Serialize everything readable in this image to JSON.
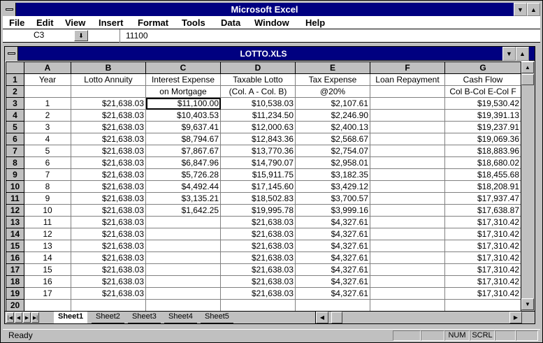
{
  "app": {
    "title": "Microsoft Excel"
  },
  "menu": [
    "File",
    "Edit",
    "View",
    "Insert",
    "Format",
    "Tools",
    "Data",
    "Window",
    "Help"
  ],
  "formula_bar": {
    "cell_ref": "C3",
    "value": "11100"
  },
  "workbook": {
    "title": "LOTTO.XLS"
  },
  "columns": [
    "A",
    "B",
    "C",
    "D",
    "E",
    "F",
    "G"
  ],
  "header_rows": [
    [
      "Year",
      "Lotto Annuity",
      "Interest Expense",
      "Taxable Lotto",
      "Tax Expense",
      "Loan Repayment",
      "Cash Flow"
    ],
    [
      "",
      "",
      "on Mortgage",
      "(Col. A - Col. B)",
      "@20%",
      "",
      "Col B-Col E-Col F"
    ]
  ],
  "data_rows": [
    [
      "1",
      "$21,638.03",
      "$11,100.00",
      "$10,538.03",
      "$2,107.61",
      "",
      "$19,530.42"
    ],
    [
      "2",
      "$21,638.03",
      "$10,403.53",
      "$11,234.50",
      "$2,246.90",
      "",
      "$19,391.13"
    ],
    [
      "3",
      "$21,638.03",
      "$9,637.41",
      "$12,000.63",
      "$2,400.13",
      "",
      "$19,237.91"
    ],
    [
      "4",
      "$21,638.03",
      "$8,794.67",
      "$12,843.36",
      "$2,568.67",
      "",
      "$19,069.36"
    ],
    [
      "5",
      "$21,638.03",
      "$7,867.67",
      "$13,770.36",
      "$2,754.07",
      "",
      "$18,883.96"
    ],
    [
      "6",
      "$21,638.03",
      "$6,847.96",
      "$14,790.07",
      "$2,958.01",
      "",
      "$18,680.02"
    ],
    [
      "7",
      "$21,638.03",
      "$5,726.28",
      "$15,911.75",
      "$3,182.35",
      "",
      "$18,455.68"
    ],
    [
      "8",
      "$21,638.03",
      "$4,492.44",
      "$17,145.60",
      "$3,429.12",
      "",
      "$18,208.91"
    ],
    [
      "9",
      "$21,638.03",
      "$3,135.21",
      "$18,502.83",
      "$3,700.57",
      "",
      "$17,937.47"
    ],
    [
      "10",
      "$21,638.03",
      "$1,642.25",
      "$19,995.78",
      "$3,999.16",
      "",
      "$17,638.87"
    ],
    [
      "11",
      "$21,638.03",
      "",
      "$21,638.03",
      "$4,327.61",
      "",
      "$17,310.42"
    ],
    [
      "12",
      "$21,638.03",
      "",
      "$21,638.03",
      "$4,327.61",
      "",
      "$17,310.42"
    ],
    [
      "13",
      "$21,638.03",
      "",
      "$21,638.03",
      "$4,327.61",
      "",
      "$17,310.42"
    ],
    [
      "14",
      "$21,638.03",
      "",
      "$21,638.03",
      "$4,327.61",
      "",
      "$17,310.42"
    ],
    [
      "15",
      "$21,638.03",
      "",
      "$21,638.03",
      "$4,327.61",
      "",
      "$17,310.42"
    ],
    [
      "16",
      "$21,638.03",
      "",
      "$21,638.03",
      "$4,327.61",
      "",
      "$17,310.42"
    ],
    [
      "17",
      "$21,638.03",
      "",
      "$21,638.03",
      "$4,327.61",
      "",
      "$17,310.42"
    ]
  ],
  "row_numbers": [
    "1",
    "2",
    "3",
    "4",
    "5",
    "6",
    "7",
    "8",
    "9",
    "10",
    "11",
    "12",
    "13",
    "14",
    "15",
    "16",
    "17",
    "18",
    "19",
    "20"
  ],
  "sheets": [
    "Sheet1",
    "Sheet2",
    "Sheet3",
    "Sheet4",
    "Sheet5"
  ],
  "status": {
    "text": "Ready",
    "num": "NUM",
    "scrl": "SCRL"
  },
  "colors": {
    "title_bar": "#000080",
    "chrome": "#c0c0c0"
  }
}
